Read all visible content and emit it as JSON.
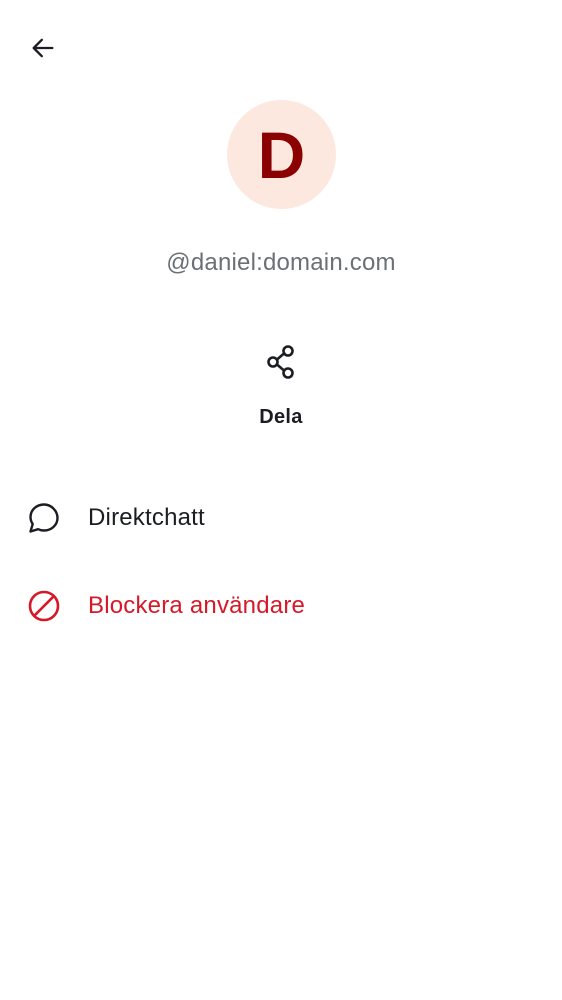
{
  "header": {
    "back_icon": "arrow-left-icon"
  },
  "profile": {
    "avatar_letter": "D",
    "avatar_bg": "#fde8df",
    "avatar_fg": "#8b0000",
    "user_id": "@daniel:domain.com"
  },
  "actions": {
    "share_icon": "share-icon",
    "share_label": "Dela"
  },
  "menu": {
    "items": [
      {
        "icon": "chat-bubble-icon",
        "label": "Direktchatt",
        "color": "#1b1d22"
      },
      {
        "icon": "block-icon",
        "label": "Blockera användare",
        "color": "#d51928"
      }
    ]
  }
}
